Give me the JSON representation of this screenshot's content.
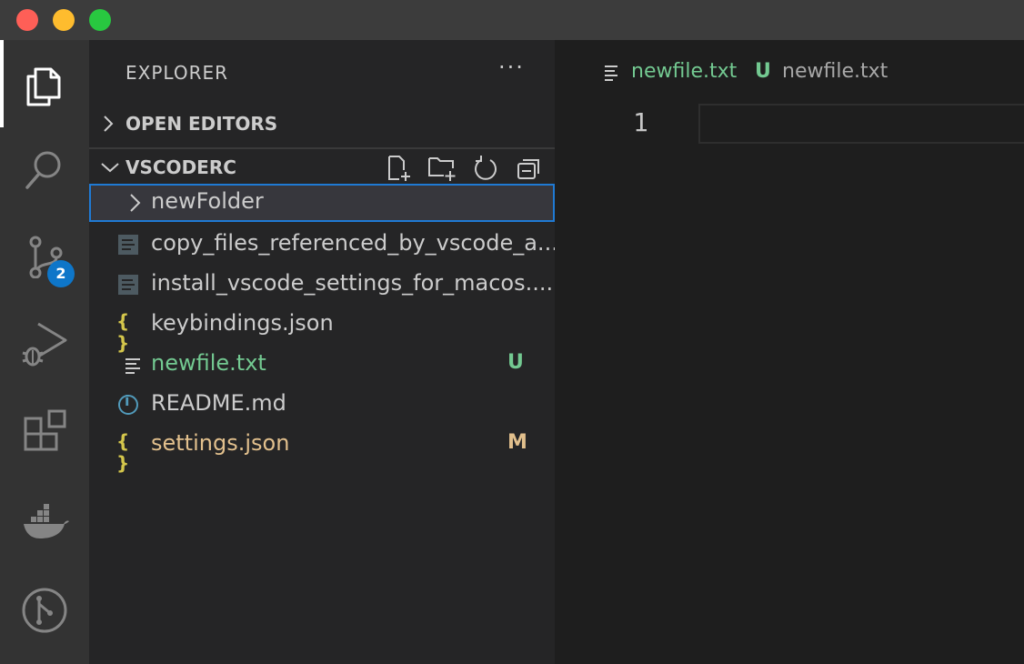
{
  "sidebar": {
    "title": "EXPLORER",
    "more_label": "···",
    "open_editors_label": "OPEN EDITORS",
    "folder_label": "VSCODERC",
    "items": [
      {
        "name": "newFolder",
        "type": "folder",
        "status": ""
      },
      {
        "name": "copy_files_referenced_by_vscode_a...",
        "type": "file",
        "status": ""
      },
      {
        "name": "install_vscode_settings_for_macos....",
        "type": "file",
        "status": ""
      },
      {
        "name": "keybindings.json",
        "type": "json",
        "status": ""
      },
      {
        "name": "newfile.txt",
        "type": "text",
        "status": "U"
      },
      {
        "name": "README.md",
        "type": "info",
        "status": ""
      },
      {
        "name": "settings.json",
        "type": "json",
        "status": "M"
      }
    ]
  },
  "activity": {
    "scm_badge": "2"
  },
  "editor": {
    "breadcrumb_file": "newfile.txt",
    "breadcrumb_status": "U",
    "breadcrumb_path": "newfile.txt",
    "line_number": "1"
  },
  "icons": {
    "json_braces": "{ }",
    "info": "i"
  },
  "colors": {
    "untracked": "#73c991",
    "modified": "#e2c08d",
    "accent": "#1f7ad4",
    "badge": "#0e76c9"
  }
}
